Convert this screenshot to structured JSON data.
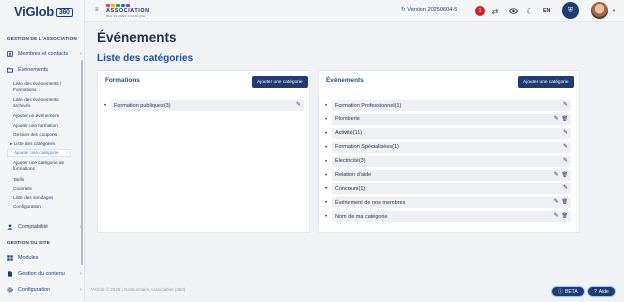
{
  "logo": {
    "text": "ViGlob",
    "badge": "360"
  },
  "sidebar": {
    "section1": "GESTION DE L'ASSOCIATION",
    "members": "Membres et contacts",
    "events": "Événements",
    "subitems": [
      "Liste des événements / Formations",
      "Liste des événements archivés",
      "Ajouter un événement",
      "Ajouter une formation",
      "Gestion des coupons",
      "Liste des catégories",
      "Ajouter une catégorie",
      "Ajouter une catégorie de formations",
      "Tarifs",
      "Courriels",
      "Liste des sondages",
      "Configuration"
    ],
    "comptabilite": "Comptabilité",
    "section2": "GESTION DU SITE",
    "modules": "Modules",
    "contenu": "Gestion du contenu",
    "configuration": "Configuration"
  },
  "topbar": {
    "assoc_title": "ASSOCIATION",
    "assoc_sub": "DES JEUNES D'AFRIQUE",
    "version": "Version 20250604-5",
    "notif_count": "1",
    "lang": "EN"
  },
  "page": {
    "title": "Événements",
    "subtitle": "Liste des catégories"
  },
  "formations_card": {
    "title": "Formations",
    "add_label": "Ajouter une catégorie",
    "rows": [
      {
        "label": "Formation publiques(3)",
        "deletable": false
      }
    ]
  },
  "events_card": {
    "title": "Événements",
    "add_label": "Ajouter une catégorie",
    "rows": [
      {
        "label": "Formation Professionnel(1)",
        "deletable": false
      },
      {
        "label": "Plomberie",
        "deletable": true
      },
      {
        "label": "Activité(11)",
        "deletable": false
      },
      {
        "label": "Formation Spécialisées(1)",
        "deletable": false
      },
      {
        "label": "Electricité(3)",
        "deletable": false
      },
      {
        "label": "Relation d'aide",
        "deletable": true
      },
      {
        "label": "Concours(1)",
        "deletable": false
      },
      {
        "label": "Événement de nos membres",
        "deletable": true
      },
      {
        "label": "Nom de ma catégorie",
        "deletable": true
      }
    ]
  },
  "footer": {
    "copyright": "ViGlob © 2026 | Gestionnaire Association (360)",
    "beta": "BETA",
    "aide": "Aide"
  },
  "colors": {
    "primary": "#1f3b73",
    "accent": "#2e7bd6",
    "notif": "#c7252b"
  }
}
